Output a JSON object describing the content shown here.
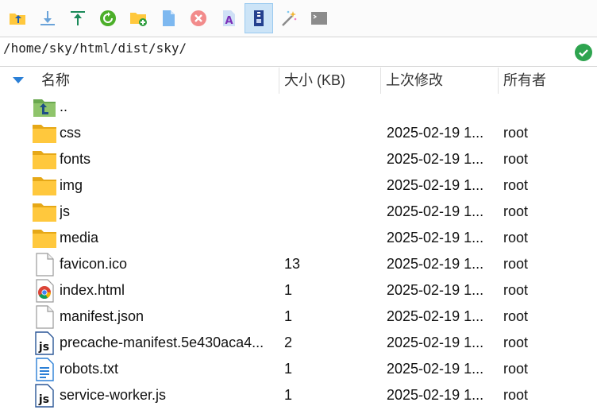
{
  "toolbar": {
    "buttons": [
      {
        "name": "upload-folder-icon"
      },
      {
        "name": "download-icon"
      },
      {
        "name": "upload-icon"
      },
      {
        "name": "refresh-icon"
      },
      {
        "name": "new-folder-icon"
      },
      {
        "name": "new-file-icon"
      },
      {
        "name": "delete-icon"
      },
      {
        "name": "rename-icon"
      },
      {
        "name": "compress-icon",
        "active": true
      },
      {
        "name": "magic-wand-icon"
      },
      {
        "name": "terminal-icon"
      }
    ]
  },
  "path": {
    "value": "/home/sky/html/dist/sky/",
    "status_icon": "check-circle-icon"
  },
  "columns": {
    "name": "名称",
    "size": "大小 (KB)",
    "modified": "上次修改",
    "owner": "所有者"
  },
  "files": [
    {
      "icon": "parent-folder-icon",
      "name": "..",
      "size": "",
      "modified": "",
      "owner": ""
    },
    {
      "icon": "folder-icon",
      "name": "css",
      "size": "",
      "modified": "2025-02-19 1...",
      "owner": "root"
    },
    {
      "icon": "folder-icon",
      "name": "fonts",
      "size": "",
      "modified": "2025-02-19 1...",
      "owner": "root"
    },
    {
      "icon": "folder-icon",
      "name": "img",
      "size": "",
      "modified": "2025-02-19 1...",
      "owner": "root"
    },
    {
      "icon": "folder-icon",
      "name": "js",
      "size": "",
      "modified": "2025-02-19 1...",
      "owner": "root"
    },
    {
      "icon": "folder-icon",
      "name": "media",
      "size": "",
      "modified": "2025-02-19 1...",
      "owner": "root"
    },
    {
      "icon": "file-icon",
      "name": "favicon.ico",
      "size": "13",
      "modified": "2025-02-19 1...",
      "owner": "root"
    },
    {
      "icon": "chrome-html-icon",
      "name": "index.html",
      "size": "1",
      "modified": "2025-02-19 1...",
      "owner": "root"
    },
    {
      "icon": "file-icon",
      "name": "manifest.json",
      "size": "1",
      "modified": "2025-02-19 1...",
      "owner": "root"
    },
    {
      "icon": "js-file-icon",
      "name": "precache-manifest.5e430aca4...",
      "size": "2",
      "modified": "2025-02-19 1...",
      "owner": "root"
    },
    {
      "icon": "text-file-icon",
      "name": "robots.txt",
      "size": "1",
      "modified": "2025-02-19 1...",
      "owner": "root"
    },
    {
      "icon": "js-file-icon",
      "name": "service-worker.js",
      "size": "1",
      "modified": "2025-02-19 1...",
      "owner": "root"
    }
  ],
  "colors": {
    "folder": "#ffc83d",
    "accent_blue": "#2b7fd6",
    "ok_green": "#2ea44f"
  }
}
